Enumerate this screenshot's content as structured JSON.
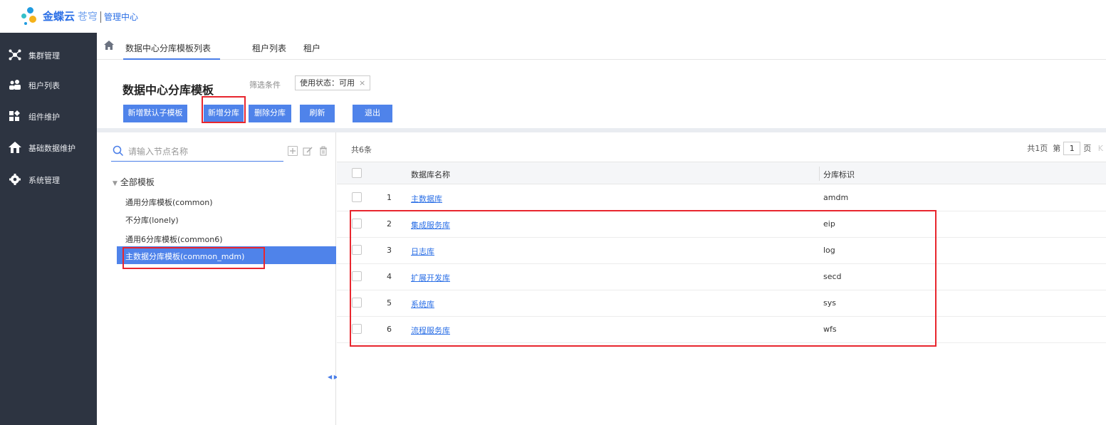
{
  "header": {
    "brand_name": "金蝶云",
    "brand_sub": "苍穹",
    "module": "管理中心"
  },
  "sidebar": {
    "items": [
      {
        "label": "集群管理",
        "icon": "cluster-icon"
      },
      {
        "label": "租户列表",
        "icon": "users-icon"
      },
      {
        "label": "组件维护",
        "icon": "components-icon"
      },
      {
        "label": "基础数据维护",
        "icon": "house-icon"
      },
      {
        "label": "系统管理",
        "icon": "gear-icon"
      }
    ]
  },
  "tabs": [
    {
      "label": "数据中心分库模板列表",
      "active": true
    },
    {
      "label": "租户列表",
      "active": false
    },
    {
      "label": "租户",
      "active": false
    }
  ],
  "page": {
    "title": "数据中心分库模板",
    "filter_label": "筛选条件",
    "filter_tag": "使用状态：可用",
    "filter_close": "×"
  },
  "toolbar": {
    "buttons": [
      "新增默认子模板",
      "新增分库",
      "删除分库",
      "刷新",
      "退出"
    ]
  },
  "tree": {
    "search_placeholder": "请输入节点名称",
    "root": "全部模板",
    "caret": "▼",
    "nodes": [
      "通用分库模板(common)",
      "不分库(lonely)",
      "通用6分库模板(common6)",
      "主数据分库模板(common_mdm)"
    ],
    "selected_index": 3
  },
  "table": {
    "count": "共6条",
    "pager": {
      "total": "共1页",
      "prefix": "第",
      "page": "1",
      "suffix": "页",
      "last": "K"
    },
    "columns": [
      "数据库名称",
      "分库标识"
    ],
    "rows": [
      {
        "num": "1",
        "name": "主数据库",
        "code": "amdm"
      },
      {
        "num": "2",
        "name": "集成服务库",
        "code": "eip"
      },
      {
        "num": "3",
        "name": "日志库",
        "code": "log"
      },
      {
        "num": "4",
        "name": "扩展开发库",
        "code": "secd"
      },
      {
        "num": "5",
        "name": "系统库",
        "code": "sys"
      },
      {
        "num": "6",
        "name": "流程服务库",
        "code": "wfs"
      }
    ]
  },
  "colors": {
    "sidebar_bg": "#2d3441",
    "accent": "#4f83ea",
    "link": "#2b6fe6",
    "annotation": "#e8262e"
  }
}
